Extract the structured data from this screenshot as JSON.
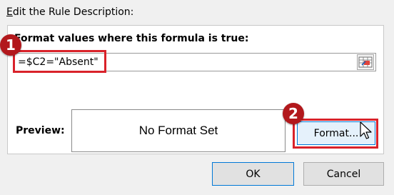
{
  "section": {
    "title_accel": "E",
    "title_rest": "dit the Rule Description:"
  },
  "formula": {
    "label": "Format values where this formula is true:",
    "value": "=$C2=\"Absent\"",
    "ref_icon": "range-select-icon"
  },
  "preview": {
    "label": "Preview:",
    "text": "No Format Set"
  },
  "buttons": {
    "format": "Format...",
    "ok": "OK",
    "cancel": "Cancel"
  },
  "annotations": {
    "step1": "1",
    "step2": "2",
    "highlight_color": "#d9222a",
    "badge_color": "#b2181c"
  }
}
